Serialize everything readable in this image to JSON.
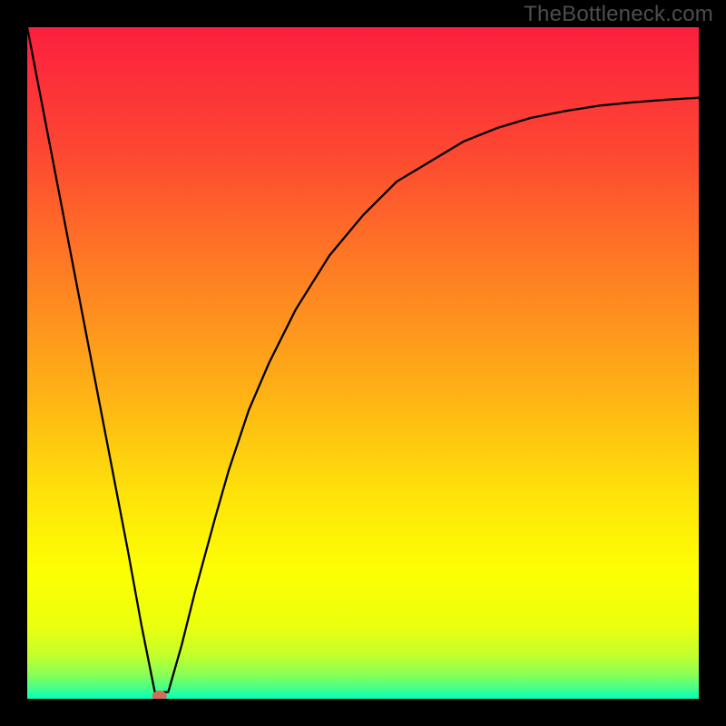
{
  "watermark": "TheBottleneck.com",
  "chart_data": {
    "type": "line",
    "title": "",
    "xlabel": "",
    "ylabel": "",
    "x_range": [
      0,
      100
    ],
    "y_range": [
      0,
      100
    ],
    "grid": false,
    "legend": false,
    "series": [
      {
        "name": "curve",
        "x": [
          0,
          5,
          10,
          15,
          17,
          19,
          21,
          23,
          25,
          28,
          30,
          33,
          36,
          40,
          45,
          50,
          55,
          60,
          65,
          70,
          75,
          80,
          85,
          90,
          95,
          100
        ],
        "y": [
          100,
          74,
          48,
          22,
          11,
          1,
          1,
          8,
          16,
          27,
          34,
          43,
          50,
          58,
          66,
          72,
          77,
          80,
          83,
          85,
          86.5,
          87.5,
          88.3,
          88.8,
          89.2,
          89.5
        ]
      }
    ],
    "marker": {
      "x": 19.7,
      "y": 0,
      "color": "#d46a5a"
    },
    "background_gradient": {
      "stops": [
        {
          "offset": 0.0,
          "color": "#fb1f3f"
        },
        {
          "offset": 0.18,
          "color": "#fd4632"
        },
        {
          "offset": 0.36,
          "color": "#fe7c24"
        },
        {
          "offset": 0.54,
          "color": "#feb016"
        },
        {
          "offset": 0.7,
          "color": "#fee409"
        },
        {
          "offset": 0.81,
          "color": "#fdff03"
        },
        {
          "offset": 0.89,
          "color": "#ecff0d"
        },
        {
          "offset": 0.935,
          "color": "#c3ff2c"
        },
        {
          "offset": 0.965,
          "color": "#87ff59"
        },
        {
          "offset": 0.985,
          "color": "#42ff8c"
        },
        {
          "offset": 1.0,
          "color": "#04ffba"
        }
      ]
    }
  }
}
